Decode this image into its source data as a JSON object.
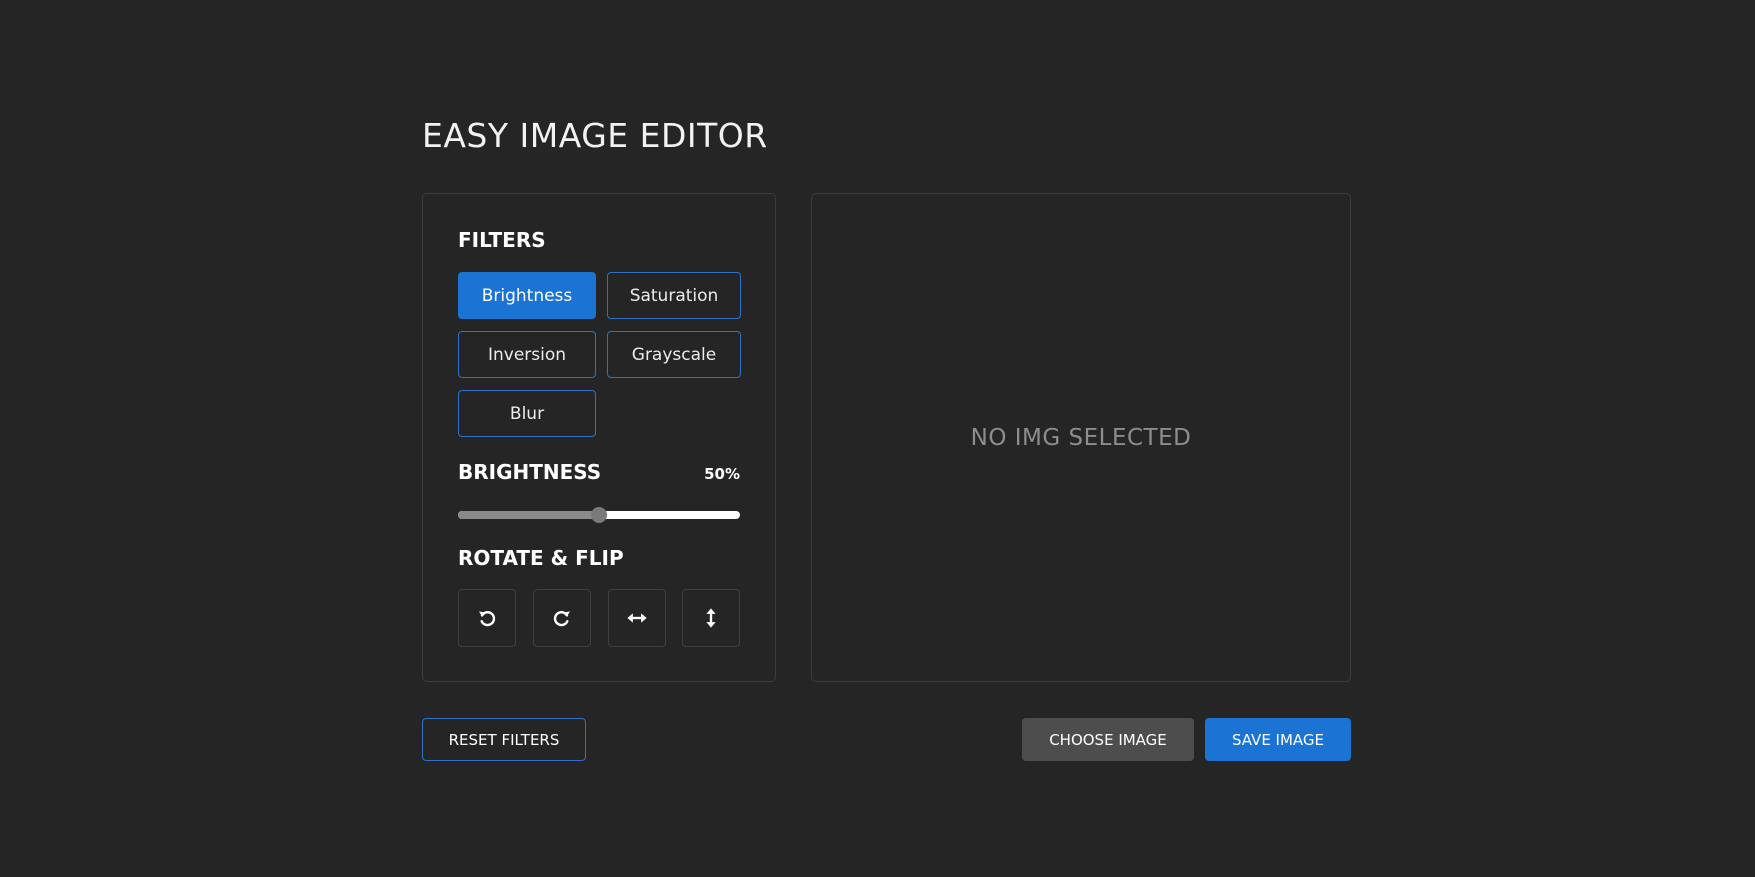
{
  "app": {
    "title": "EASY IMAGE EDITOR"
  },
  "filters": {
    "heading": "FILTERS",
    "buttons": [
      {
        "label": "Brightness",
        "active": true
      },
      {
        "label": "Saturation",
        "active": false
      },
      {
        "label": "Inversion",
        "active": false
      },
      {
        "label": "Grayscale",
        "active": false
      },
      {
        "label": "Blur",
        "active": false
      }
    ]
  },
  "slider": {
    "name": "BRIGHTNESS",
    "value_text": "50%",
    "value_fraction": 0.5
  },
  "rotate_flip": {
    "heading": "ROTATE & FLIP",
    "buttons": [
      {
        "icon": "rotate-left-icon"
      },
      {
        "icon": "rotate-right-icon"
      },
      {
        "icon": "flip-horizontal-icon"
      },
      {
        "icon": "flip-vertical-icon"
      }
    ]
  },
  "preview": {
    "placeholder": "NO IMG SELECTED"
  },
  "actions": {
    "reset_label": "RESET FILTERS",
    "choose_label": "CHOOSE IMAGE",
    "save_label": "SAVE IMAGE"
  },
  "colors": {
    "background": "#252525",
    "accent": "#1b74d4",
    "border": "#3c3c3c",
    "choose_button": "#4d4d4d"
  }
}
